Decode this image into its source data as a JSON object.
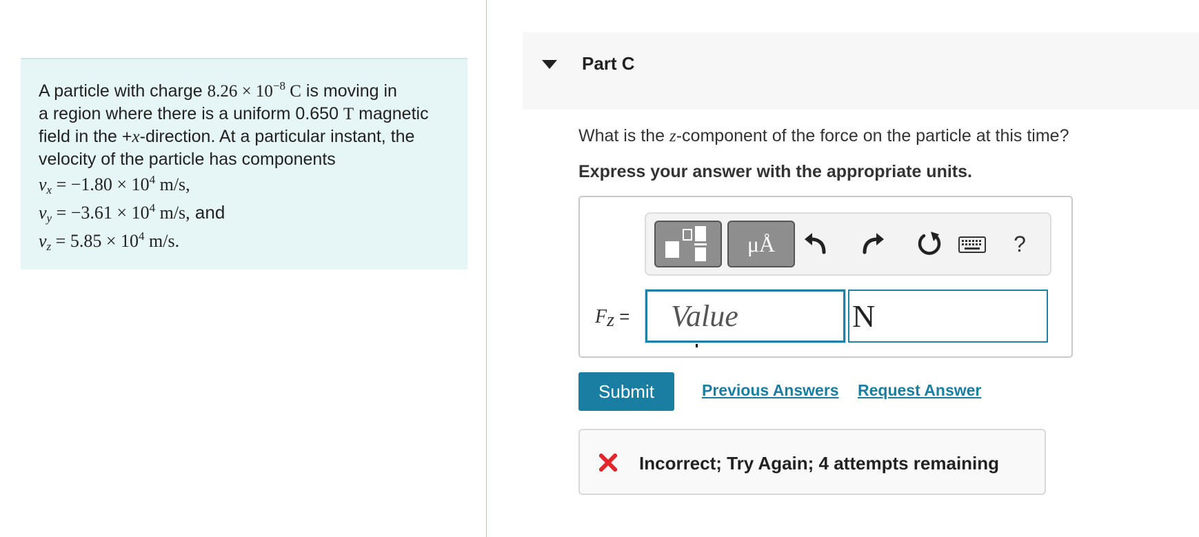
{
  "problem": {
    "line1": {
      "a": "A particle with charge ",
      "charge_mantissa": "8.26 × 10",
      "charge_exp": "−8",
      "charge_unit": " C",
      "b": " is moving in"
    },
    "line2": {
      "a": "a region where there is a uniform 0.650 ",
      "field_unit": "T",
      "b": " magnetic"
    },
    "line3": {
      "a": "field in the +",
      "axis": "x",
      "b": "-direction. At a particular instant, the"
    },
    "line4": "velocity of the particle has components",
    "vx": {
      "var": "v",
      "sub": "x",
      "mantissa": " = −1.80 × 10",
      "exp": "4",
      "unit": " m/s,",
      "suffix": ""
    },
    "vy": {
      "var": "v",
      "sub": "y",
      "mantissa": " = −3.61 × 10",
      "exp": "4",
      "unit": " m/s,",
      "suffix": " and"
    },
    "vz": {
      "var": "v",
      "sub": "z",
      "mantissa": " = 5.85 × 10",
      "exp": "4",
      "unit": " m/s.",
      "suffix": ""
    }
  },
  "part": {
    "title": "Part C"
  },
  "question": {
    "a": "What is the ",
    "axis": "z",
    "b": "-component of the force on the particle at this time?"
  },
  "instruction": "Express your answer with the appropriate units.",
  "toolbar": {
    "units_label": "μÅ",
    "help_label": "?"
  },
  "answer": {
    "label_var": "F",
    "label_sub": "z",
    "label_eq": " =",
    "value_placeholder": "Value",
    "unit_value": "N"
  },
  "actions": {
    "submit_label": "Submit",
    "previous_answers_label": "Previous Answers",
    "request_answer_label": "Request Answer"
  },
  "feedback": {
    "text": "Incorrect; Try Again; 4 attempts remaining"
  },
  "colors": {
    "accent": "#1a7ea3",
    "error": "#e3262b",
    "panel_bg": "#e6f6f6"
  }
}
